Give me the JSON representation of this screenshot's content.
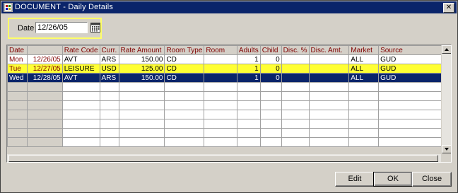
{
  "window": {
    "title": "DOCUMENT - Daily Details"
  },
  "date_filter": {
    "label": "Date",
    "value": "12/26/05"
  },
  "grid": {
    "columns": [
      "Date",
      "",
      "Rate Code",
      "Curr.",
      "Rate Amount",
      "Room Type",
      "Room",
      "Adults",
      "Child",
      "Disc. %",
      "Disc. Amt.",
      "Market",
      "Source"
    ],
    "rows": [
      {
        "day": "Mon",
        "date": "12/26/05",
        "rate_code": "AVT",
        "curr": "ARS",
        "rate_amount": "150.00",
        "room_type": "CD",
        "room": "",
        "adults": "1",
        "child": "0",
        "disc_pct": "",
        "disc_amt": "",
        "market": "ALL",
        "source": "GUD",
        "state": "normal"
      },
      {
        "day": "Tue",
        "date": "12/27/05",
        "rate_code": "LEISURE",
        "curr": "USD",
        "rate_amount": "125.00",
        "room_type": "CD",
        "room": "",
        "adults": "1",
        "child": "0",
        "disc_pct": "",
        "disc_amt": "",
        "market": "ALL",
        "source": "GUD",
        "state": "highlight"
      },
      {
        "day": "Wed",
        "date": "12/28/05",
        "rate_code": "AVT",
        "curr": "ARS",
        "rate_amount": "150.00",
        "room_type": "CD",
        "room": "",
        "adults": "1",
        "child": "0",
        "disc_pct": "",
        "disc_amt": "",
        "market": "ALL",
        "source": "GUD",
        "state": "selected"
      }
    ],
    "empty_rows": 7
  },
  "buttons": {
    "edit": "Edit",
    "ok": "OK",
    "close": "Close"
  },
  "colors": {
    "titlebar": "#0a246a",
    "header_text": "#800000",
    "highlight_row": "#ffff33",
    "selected_row": "#0a246a",
    "focus_box": "#ffff66"
  }
}
